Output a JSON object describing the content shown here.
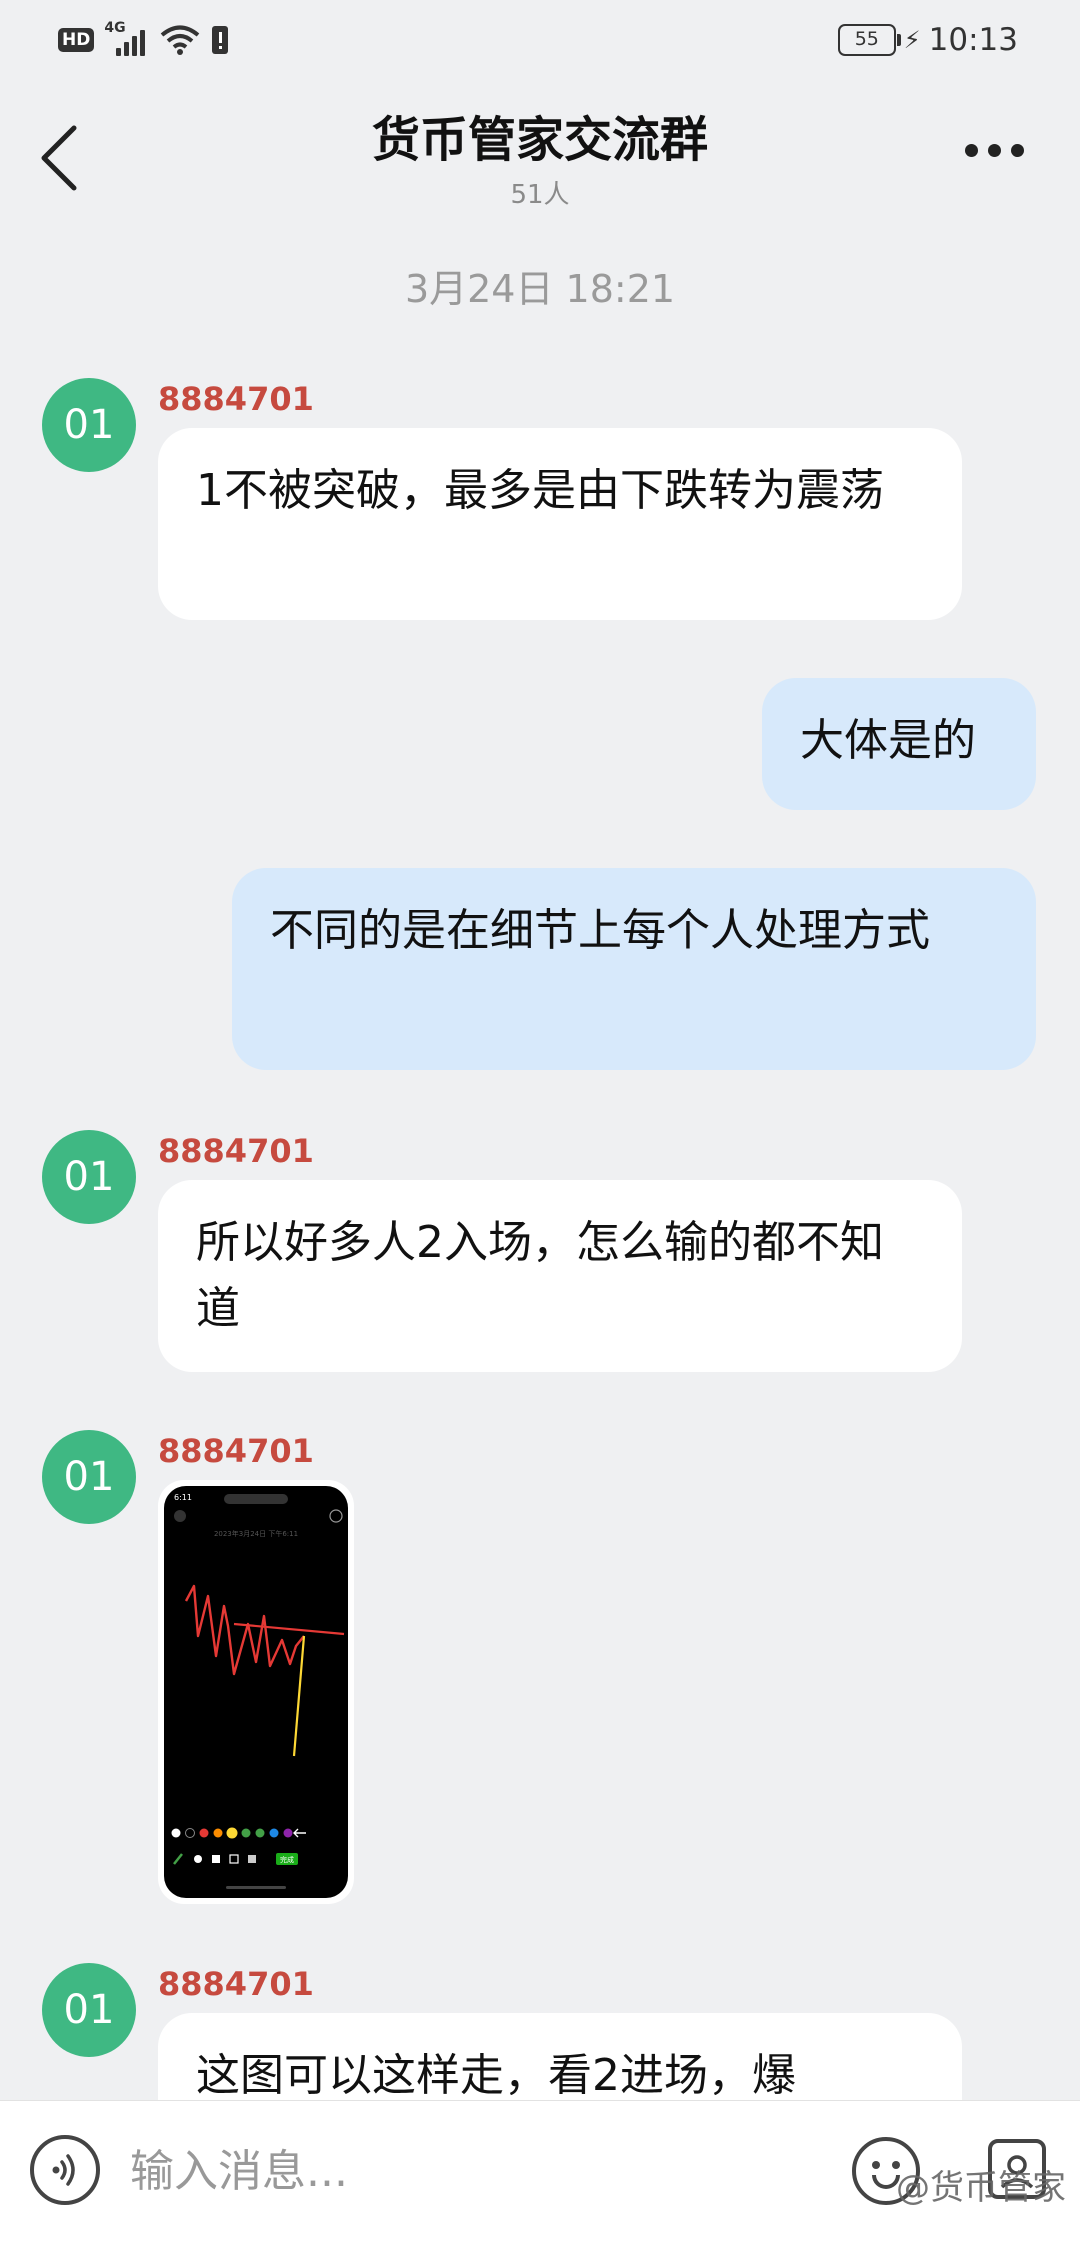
{
  "status_bar": {
    "hd": "HD",
    "network": "4G",
    "battery": "55",
    "time": "10:13"
  },
  "header": {
    "title": "货币管家交流群",
    "subtitle": "51人"
  },
  "date_separator": "3月24日 18:21",
  "messages": [
    {
      "avatar": "01",
      "sender": "8884701",
      "text": "1不被突破，最多是由下跌转为震荡"
    },
    {
      "text": "大体是的"
    },
    {
      "text": "不同的是在细节上每个人处理方式"
    },
    {
      "avatar": "01",
      "sender": "8884701",
      "text": "所以好多人2入场，怎么输的都不知道"
    },
    {
      "avatar": "01",
      "sender": "8884701",
      "image": {
        "top_time": "6:11",
        "status_text": "2023年3月24日 下午6:11",
        "done_label": "完成",
        "palette": [
          "#ffffff",
          "#000000",
          "#e53935",
          "#fb8c00",
          "#fdd835",
          "#43a047",
          "#1e88e5",
          "#8e24aa"
        ]
      }
    },
    {
      "avatar": "01",
      "sender": "8884701",
      "text": "这图可以这样走，看2进场，爆"
    }
  ],
  "input_bar": {
    "placeholder": "输入消息..."
  },
  "watermark": "@货币管家",
  "colors": {
    "background": "#eff0f2",
    "incoming_bubble": "#ffffff",
    "outgoing_bubble": "#d7e9fb",
    "avatar": "#3fb883",
    "sender_name": "#c64a3f"
  }
}
